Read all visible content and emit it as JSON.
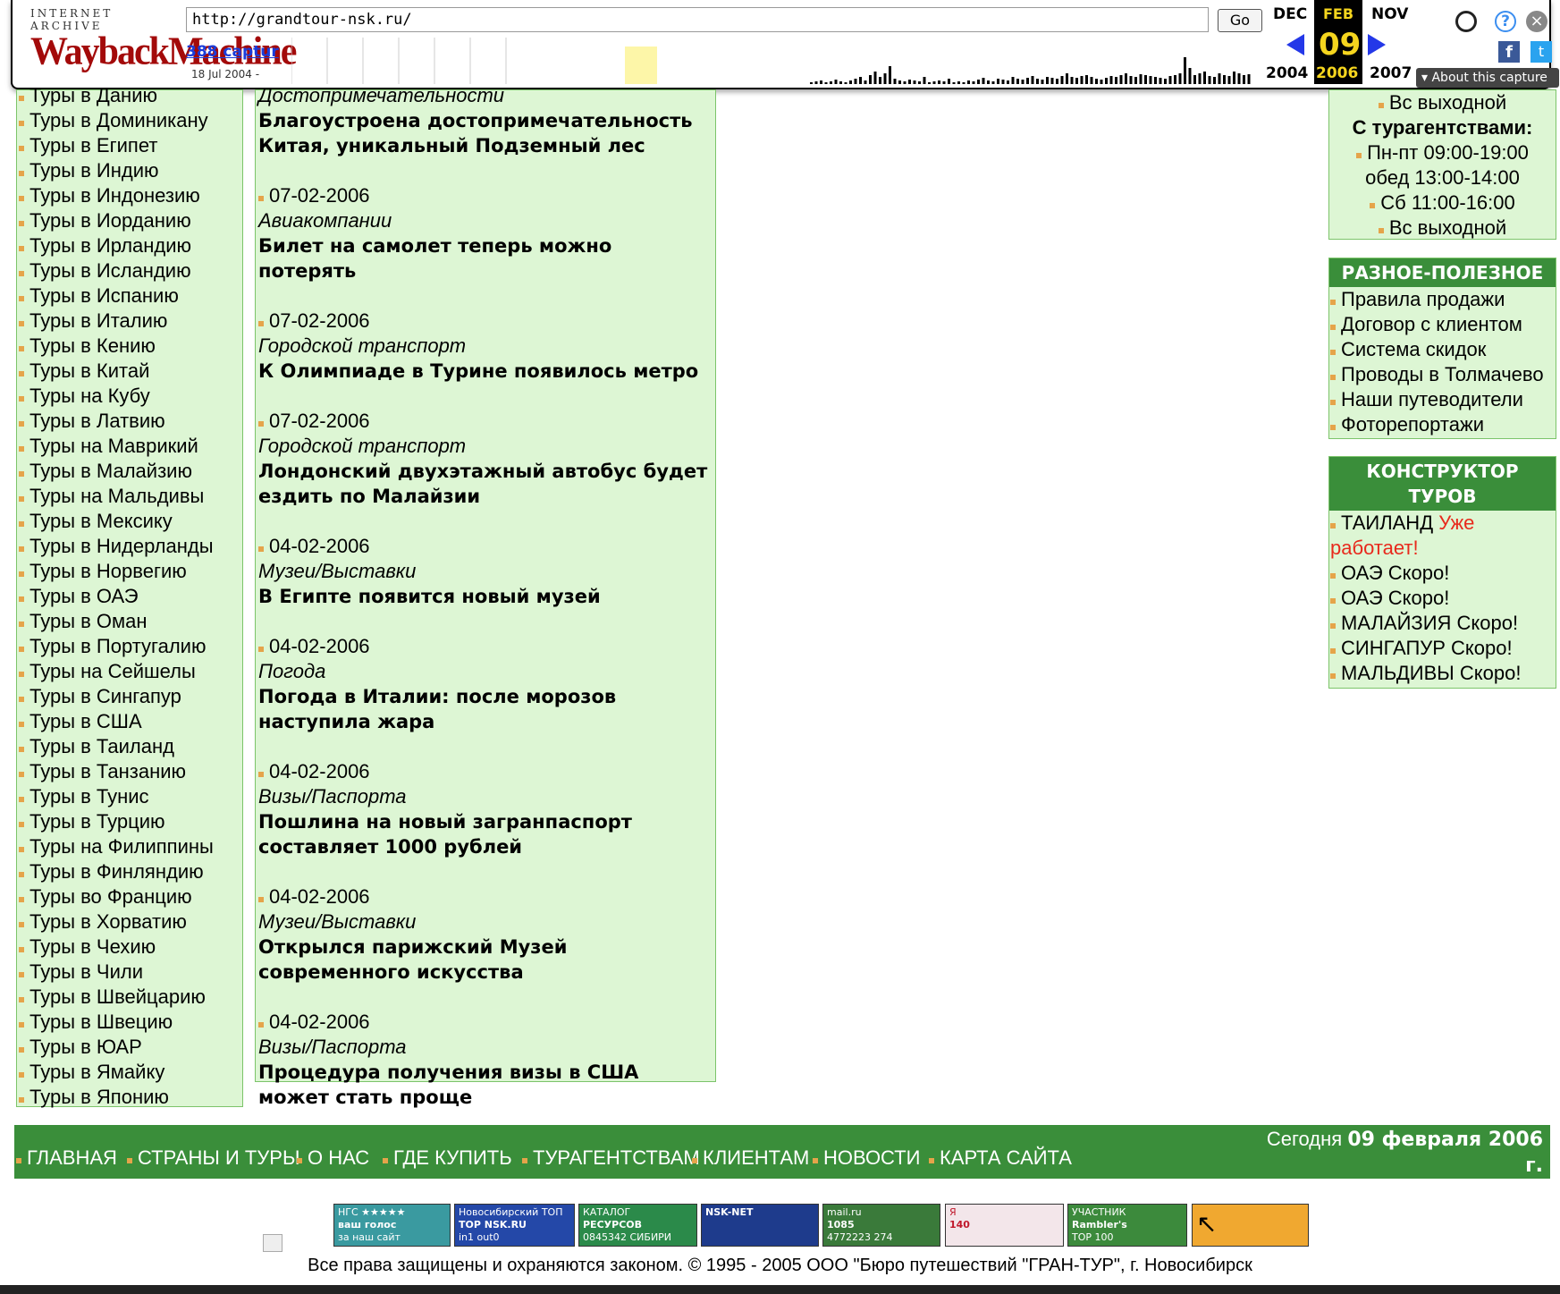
{
  "wayback": {
    "brand_top": "INTERNET ARCHIVE",
    "brand_main": "WaybackMachine",
    "url": "http://grandtour-nsk.ru/",
    "go_label": "Go",
    "captures": "388 captur",
    "date_range": "18 Jul 2004 -",
    "prev_month": "DEC",
    "cur_month": "FEB",
    "next_month": "NOV",
    "cur_day": "09",
    "prev_year": "2004",
    "cur_year": "2006",
    "next_year": "2007",
    "about": "About this capture"
  },
  "left_column": {
    "tours": [
      "Туры в Данию",
      "Туры в Доминикану",
      "Туры в Египет",
      "Туры в Индию",
      "Туры в Индонезию",
      "Туры в Иорданию",
      "Туры в Ирландию",
      "Туры в Исландию",
      "Туры в Испанию",
      "Туры в Италию",
      "Туры в Кению",
      "Туры в Китай",
      "Туры на Кубу",
      "Туры в Латвию",
      "Туры на Маврикий",
      "Туры в Малайзию",
      "Туры на Мальдивы",
      "Туры в Мексику",
      "Туры в Нидерланды",
      "Туры в Норвегию",
      "Туры в ОАЭ",
      "Туры в Оман",
      "Туры в Португалию",
      "Туры на Сейшелы",
      "Туры в Сингапур",
      "Туры в США",
      "Туры в Таиланд",
      "Туры в Танзанию",
      "Туры в Тунис",
      "Туры в Турцию",
      "Туры на Филиппины",
      "Туры в Финляндию",
      "Туры во Францию",
      "Туры в Хорватию",
      "Туры в Чехию",
      "Туры в Чили",
      "Туры в Швейцарию",
      "Туры в Швецию",
      "Туры в ЮАР",
      "Туры в Ямайку",
      "Туры в Японию"
    ]
  },
  "news": {
    "top_cat": "Достопримечательности",
    "top_title": "Благоустроена достопримечательность Китая, уникальный Подземный лес",
    "items": [
      {
        "date": "07-02-2006",
        "category": "Авиакомпании",
        "title": "Билет на самолет теперь можно потерять"
      },
      {
        "date": "07-02-2006",
        "category": "Городской транспорт",
        "title": "К Олимпиаде в Турине появилось метро"
      },
      {
        "date": "07-02-2006",
        "category": "Городской транспорт",
        "title": "Лондонский двухэтажный автобус будет ездить по Малайзии"
      },
      {
        "date": "04-02-2006",
        "category": "Музеи/Выставки",
        "title": "В Египте появится новый музей"
      },
      {
        "date": "04-02-2006",
        "category": "Погода",
        "title": "Погода в Италии: после морозов наступила жара"
      },
      {
        "date": "04-02-2006",
        "category": "Визы/Паспорта",
        "title": "Пошлина на новый загранпаспорт составляет 1000 рублей"
      },
      {
        "date": "04-02-2006",
        "category": "Музеи/Выставки",
        "title": "Открылся парижский Музей современного искусства"
      },
      {
        "date": "04-02-2006",
        "category": "Визы/Паспорта",
        "title": "Процедура получения визы в США может стать проще"
      }
    ]
  },
  "hours": {
    "line1": "Вс выходной",
    "agency_header": "С турагентствами:",
    "line2": "Пн-пт 09:00-19:00",
    "line3": "обед 13:00-14:00",
    "line4": "Сб 11:00-16:00",
    "line5": "Вс выходной"
  },
  "useful": {
    "header": "РАЗНОЕ-ПОЛЕЗНОЕ",
    "items": [
      "Правила продажи",
      "Договор с клиентом",
      "Система скидок",
      "Проводы в Толмачево",
      "Наши путеводители",
      "Фоторепортажи"
    ]
  },
  "constructor": {
    "header": "КОНСТРУКТОР ТУРОВ",
    "items": [
      {
        "name": "ТАИЛАНД",
        "status": "Уже работает!",
        "status_color": "#e8291c"
      },
      {
        "name": "ОАЭ",
        "status": "Скоро!"
      },
      {
        "name": "ОАЭ",
        "status": "Скоро!"
      },
      {
        "name": "МАЛАЙЗИЯ",
        "status": "Скоро!"
      },
      {
        "name": "СИНГАПУР",
        "status": "Скоро!"
      },
      {
        "name": "МАЛЬДИВЫ",
        "status": "Скоро!"
      }
    ]
  },
  "footer_nav": {
    "links": [
      "ГЛАВНАЯ",
      "СТРАНЫ И ТУРЫ",
      "О НАС",
      "ГДЕ КУПИТЬ",
      "ТУРАГЕНТСТВАМ",
      "КЛИЕНТАМ",
      "НОВОСТИ",
      "КАРТА САЙТА"
    ],
    "today_prefix": "Сегодня",
    "today_date": "09 февраля 2006",
    "today_suffix": "г."
  },
  "counters": [
    {
      "name": "ngs-counter",
      "line1": "НГС ★★★★★",
      "line2": "ваш голос",
      "line3": "за наш сайт",
      "color": "#3a9aa0"
    },
    {
      "name": "nsk-top-counter",
      "line1": "Новосибирский ТОП",
      "line2": "TOP NSK.RU",
      "line3": "in1 out0",
      "color": "#2448a8"
    },
    {
      "name": "catalog-counter",
      "line1": "КАТАЛОГ",
      "line2": "РЕСУРСОВ",
      "line3": "0845342 СИБИРИ",
      "color": "#2b8a4a"
    },
    {
      "name": "nsk-net-counter",
      "line1": "",
      "line2": "NSK-NET",
      "line3": "",
      "color": "#1e3b8c"
    },
    {
      "name": "mailru-counter",
      "line1": "mail.ru",
      "line2": "1085",
      "line3": "4772223   274",
      "color": "#3a7a3a"
    },
    {
      "name": "yandex-counter",
      "line1": "Я",
      "line2": "140",
      "line3": "",
      "color": "#f3e6ea"
    },
    {
      "name": "rambler-counter",
      "line1": "УЧАСТНИК",
      "line2": "Rambler's",
      "line3": "TOP 100",
      "color": "#3c8a3c"
    },
    {
      "name": "liveinternet-counter",
      "line1": "↖",
      "line2": "",
      "line3": "",
      "color": "#f0a830"
    }
  ],
  "copyright": "Все права защищены и охраняются законом. © 1995 - 2005 ООО \"Бюро путешествий \"ГРАН-ТУР\", г. Новосибирск"
}
